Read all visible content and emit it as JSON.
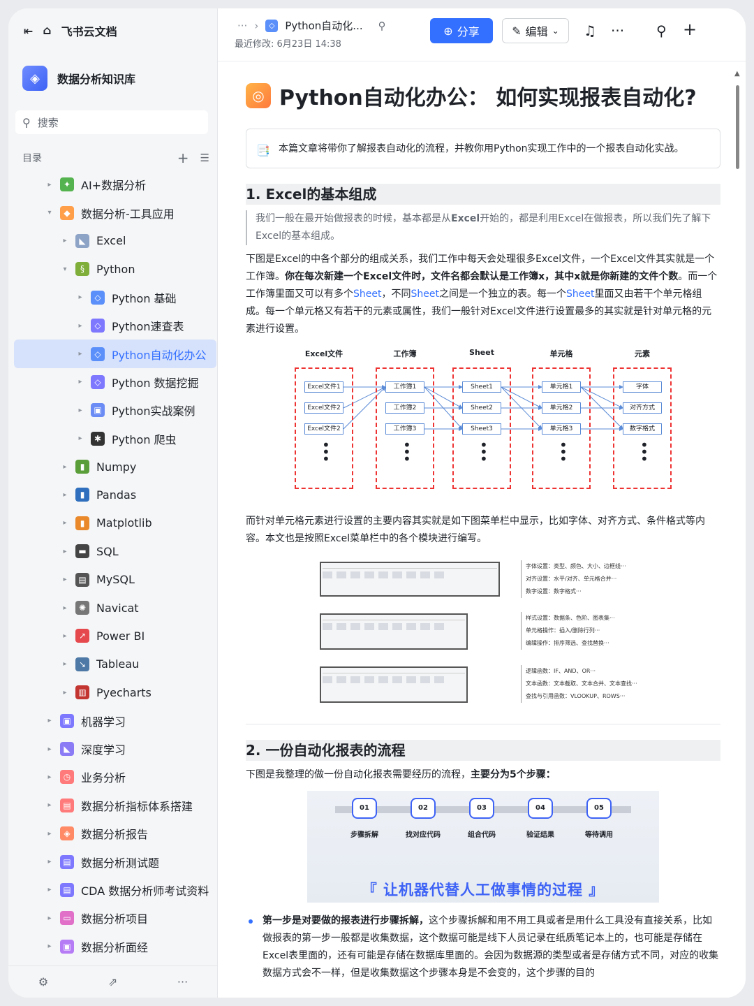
{
  "app": {
    "title": "飞书云文档"
  },
  "kb": {
    "name": "数据分析知识库"
  },
  "search": {
    "placeholder": "搜索"
  },
  "toc": {
    "label": "目录",
    "items": [
      {
        "label": "AI+数据分析",
        "level": 0,
        "arrow": "▸",
        "color": "#54b34f",
        "glyph": "✦"
      },
      {
        "label": "数据分析-工具应用",
        "level": 0,
        "arrow": "▾",
        "color": "#ff9f4a",
        "glyph": "◆"
      },
      {
        "label": "Excel",
        "level": 1,
        "arrow": "▸",
        "color": "#8ea4c7",
        "glyph": "◣"
      },
      {
        "label": "Python",
        "level": 1,
        "arrow": "▾",
        "color": "#7fae3a",
        "glyph": "§"
      },
      {
        "label": "Python 基础",
        "level": 2,
        "arrow": "▸",
        "color": "#5b8ff9",
        "glyph": "◇"
      },
      {
        "label": "Python速查表",
        "level": 2,
        "arrow": "▸",
        "color": "#7e78ff",
        "glyph": "◇"
      },
      {
        "label": "Python自动化办公",
        "level": 2,
        "arrow": "▸",
        "color": "#5b8ff9",
        "glyph": "◇",
        "selected": true
      },
      {
        "label": "Python 数据挖掘",
        "level": 2,
        "arrow": "▸",
        "color": "#7e78ff",
        "glyph": "◇"
      },
      {
        "label": "Python实战案例",
        "level": 2,
        "arrow": "▸",
        "color": "#6b8cf5",
        "glyph": "▣"
      },
      {
        "label": "Python 爬虫",
        "level": 2,
        "arrow": "▸",
        "color": "#333333",
        "glyph": "✱"
      },
      {
        "label": "Numpy",
        "level": 1,
        "arrow": "▸",
        "color": "#5a9e3a",
        "glyph": "▮"
      },
      {
        "label": "Pandas",
        "level": 1,
        "arrow": "▸",
        "color": "#2f6fbd",
        "glyph": "▮"
      },
      {
        "label": "Matplotlib",
        "level": 1,
        "arrow": "▸",
        "color": "#e9892b",
        "glyph": "▮"
      },
      {
        "label": "SQL",
        "level": 1,
        "arrow": "▸",
        "color": "#444444",
        "glyph": "▬"
      },
      {
        "label": "MySQL",
        "level": 1,
        "arrow": "▸",
        "color": "#555555",
        "glyph": "▤"
      },
      {
        "label": "Navicat",
        "level": 1,
        "arrow": "▸",
        "color": "#777777",
        "glyph": "✺"
      },
      {
        "label": "Power BI",
        "level": 1,
        "arrow": "▸",
        "color": "#e5484d",
        "glyph": "↗"
      },
      {
        "label": "Tableau",
        "level": 1,
        "arrow": "▸",
        "color": "#4e79a7",
        "glyph": "↘"
      },
      {
        "label": "Pyecharts",
        "level": 1,
        "arrow": "▸",
        "color": "#c23531",
        "glyph": "▥"
      },
      {
        "label": "机器学习",
        "level": 0,
        "arrow": "▸",
        "color": "#7e78ff",
        "glyph": "▣"
      },
      {
        "label": "深度学习",
        "level": 0,
        "arrow": "▸",
        "color": "#8b7cf6",
        "glyph": "◣"
      },
      {
        "label": "业务分析",
        "level": 0,
        "arrow": "▸",
        "color": "#ff7a7a",
        "glyph": "◷"
      },
      {
        "label": "数据分析指标体系搭建",
        "level": 0,
        "arrow": "▸",
        "color": "#ff7a7a",
        "glyph": "▤"
      },
      {
        "label": "数据分析报告",
        "level": 0,
        "arrow": "▸",
        "color": "#ff8a65",
        "glyph": "◈"
      },
      {
        "label": "数据分析测试题",
        "level": 0,
        "arrow": "▸",
        "color": "#7e78ff",
        "glyph": "▤"
      },
      {
        "label": "CDA 数据分析师考试资料",
        "level": 0,
        "arrow": "▸",
        "color": "#7e78ff",
        "glyph": "▤"
      },
      {
        "label": "数据分析项目",
        "level": 0,
        "arrow": "▸",
        "color": "#e070c8",
        "glyph": "▭"
      },
      {
        "label": "数据分析面经",
        "level": 0,
        "arrow": "▸",
        "color": "#b57cf6",
        "glyph": "▣"
      }
    ]
  },
  "topbar": {
    "breadcrumb_more": "···",
    "breadcrumb_sep": "›",
    "doc_title": "Python自动化...",
    "modified": "最近修改: 6月23日 14:38",
    "share_label": "分享",
    "edit_label": "编辑"
  },
  "doc": {
    "title": "Python自动化办公：  如何实现报表自动化?",
    "callout": "本篇文章将带你了解报表自动化的流程，并教你用Python实现工作中的一个报表自动化实战。",
    "s1_heading": "1. Excel的基本组成",
    "s1_quote_a": "我们一般在最开始做报表的时候，基本都是从",
    "s1_quote_bold": "Excel",
    "s1_quote_b": "开始的，都是利用Excel在做报表，所以我们先了解下Excel的基本组成。",
    "s1_p1_a": "下图是Excel的中各个部分的组成关系，我们工作中每天会处理很多Excel文件，一个Excel文件其实就是一个工作簿。",
    "s1_p1_bold": "你在每次新建一个Excel文件时，文件名都会默认是工作簿x，其中x就是你新建的文件个数",
    "s1_p1_b": "。而一个工作簿里面又可以有多个",
    "s1_p1_sheet1": "Sheet",
    "s1_p1_c": "，不同",
    "s1_p1_sheet2": "Sheet",
    "s1_p1_d": "之间是一个独立的表。每一个",
    "s1_p1_sheet3": "Sheet",
    "s1_p1_e": "里面又由若干个单元格组成。每一个单元格又有若干的元素或属性，我们一般针对Excel文件进行设置最多的其实就是针对单元格的元素进行设置。",
    "s1_p2": "而针对单元格元素进行设置的主要内容其实就是如下图菜单栏中显示，比如字体、对齐方式、条件格式等内容。本文也是按照Excel菜单栏中的各个模块进行编写。",
    "s2_heading": "2. 一份自动化报表的流程",
    "s2_p1_a": "下图是我整理的做一份自动化报表需要经历的流程，",
    "s2_p1_bold": "主要分为5个步骤：",
    "bullet1_bold": "第一步是对要做的报表进行步骤拆解，",
    "bullet1_rest": "这个步骤拆解和用不用工具或者是用什么工具没有直接关系，比如做报表的第一步一般都是收集数据，这个数据可能是线下人员记录在纸质笔记本上的，也可能是存储在Excel表里面的，还有可能是存储在数据库里面的。会因为数据源的类型或者是存储方式不同，对应的收集数据方式会不一样，但是收集数据这个步骤本身是不会变的，这个步骤的目的"
  },
  "diagram": {
    "headers": [
      "Excel文件",
      "工作簿",
      "Sheet",
      "单元格",
      "元素"
    ],
    "cols": [
      [
        "Excel文件1",
        "Excel文件2",
        "Excel文件2"
      ],
      [
        "工作簿1",
        "工作簿2",
        "工作簿3"
      ],
      [
        "Sheet1",
        "Sheet2",
        "Sheet3"
      ],
      [
        "单元格1",
        "单元格2",
        "单元格3"
      ],
      [
        "字体",
        "对齐方式",
        "数字格式"
      ]
    ]
  },
  "menu_notes": [
    [
      "字体设置：类型、颜色、大小、边框线···",
      "对齐设置：水平/对齐、单元格合并···",
      "数字设置：数字格式···"
    ],
    [
      "样式设置：数据条、色阶、图表集···",
      "单元格操作：插入/删除行列···",
      "编辑操作：排序筛选、查找替换···"
    ],
    [
      "逻辑函数：IF、AND、OR···",
      "文本函数：文本截取、文本合并、文本查找···",
      "查找与引用函数：VLOOKUP、ROWS···"
    ]
  ],
  "flow": {
    "steps": [
      {
        "num": "01",
        "label": "步骤拆解"
      },
      {
        "num": "02",
        "label": "找对应代码"
      },
      {
        "num": "03",
        "label": "组合代码"
      },
      {
        "num": "04",
        "label": "验证结果"
      },
      {
        "num": "05",
        "label": "等待调用"
      }
    ],
    "tagline": "『 让机器代替人工做事情的过程 』"
  },
  "colors": {
    "accent": "#3370ff",
    "selected_bg": "#d6e1fb",
    "diagram_red": "#ee3333",
    "diagram_blue": "#5b8bd6"
  }
}
